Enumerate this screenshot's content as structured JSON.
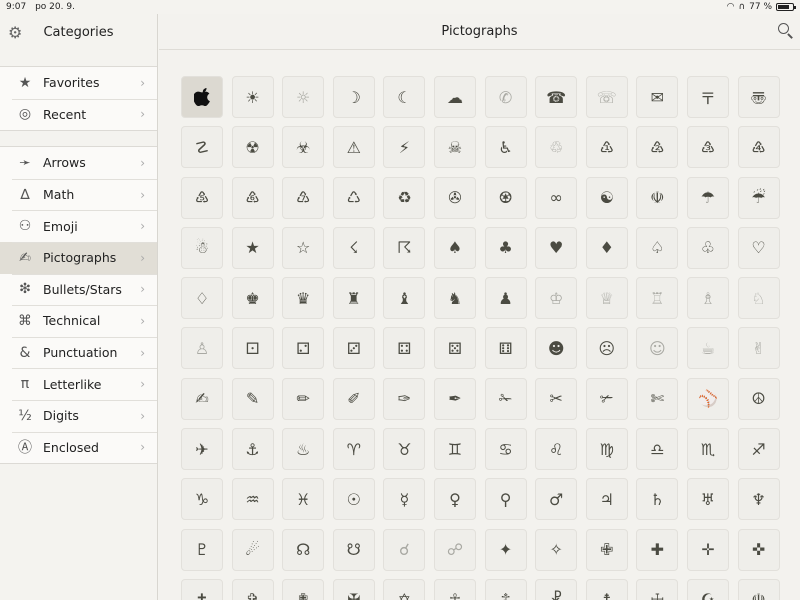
{
  "status": {
    "time": "9:07",
    "date": "po 20. 9.",
    "battery_text": "77 %",
    "battery_level": 0.77
  },
  "sidebar": {
    "title": "Categories",
    "group1": [
      {
        "icon": "★",
        "label": "Favorites"
      },
      {
        "icon": "◎",
        "label": "Recent"
      }
    ],
    "group2": [
      {
        "icon": "➛",
        "label": "Arrows"
      },
      {
        "icon": "∆",
        "label": "Math"
      },
      {
        "icon": "⚇",
        "label": "Emoji"
      },
      {
        "icon": "✍",
        "label": "Pictographs",
        "selected": true
      },
      {
        "icon": "❇",
        "label": "Bullets/Stars"
      },
      {
        "icon": "⌘",
        "label": "Technical"
      },
      {
        "icon": "&",
        "label": "Punctuation"
      },
      {
        "icon": "π",
        "label": "Letterlike"
      },
      {
        "icon": "½",
        "label": "Digits"
      },
      {
        "icon": "Ⓐ",
        "label": "Enclosed"
      }
    ]
  },
  "main": {
    "title": "Pictographs",
    "glyphs": [
      "",
      "☀",
      "☼",
      "☽",
      "☾",
      "☁",
      "✆",
      "☎",
      "☏",
      "✉",
      "〒",
      "〠",
      "☡",
      "☢",
      "☣",
      "⚠",
      "⚡",
      "☠",
      "♿",
      "♲",
      "♳",
      "♴",
      "♵",
      "♶",
      "♷",
      "♸",
      "♹",
      "♺",
      "♻",
      "✇",
      "♼",
      "∞",
      "☯",
      "☫",
      "☂",
      "☔",
      "☃",
      "★",
      "☆",
      "☇",
      "☈",
      "♠",
      "♣",
      "♥",
      "♦",
      "♤",
      "♧",
      "♡",
      "♢",
      "♚",
      "♛",
      "♜",
      "♝",
      "♞",
      "♟",
      "♔",
      "♕",
      "♖",
      "♗",
      "♘",
      "♙",
      "⚀",
      "⚁",
      "⚂",
      "⚃",
      "⚄",
      "⚅",
      "☻",
      "☹",
      "☺",
      "☕",
      "✌",
      "✍",
      "✎",
      "✏",
      "✐",
      "✑",
      "✒",
      "✁",
      "✂",
      "✃",
      "✄",
      "⚾",
      "☮",
      "✈",
      "⚓",
      "♨",
      "♈",
      "♉",
      "♊",
      "♋",
      "♌",
      "♍",
      "♎",
      "♏",
      "♐",
      "♑",
      "♒",
      "♓",
      "☉",
      "☿",
      "♀",
      "⚲",
      "♂",
      "♃",
      "♄",
      "♅",
      "♆",
      "♇",
      "☄",
      "☊",
      "☋",
      "☌",
      "☍",
      "✦",
      "✧",
      "✙",
      "✚",
      "✛",
      "✜",
      "✝",
      "✞",
      "✟",
      "✠",
      "✡",
      "☥",
      "☦",
      "☧",
      "☨",
      "☩",
      "☪",
      "☫"
    ]
  }
}
